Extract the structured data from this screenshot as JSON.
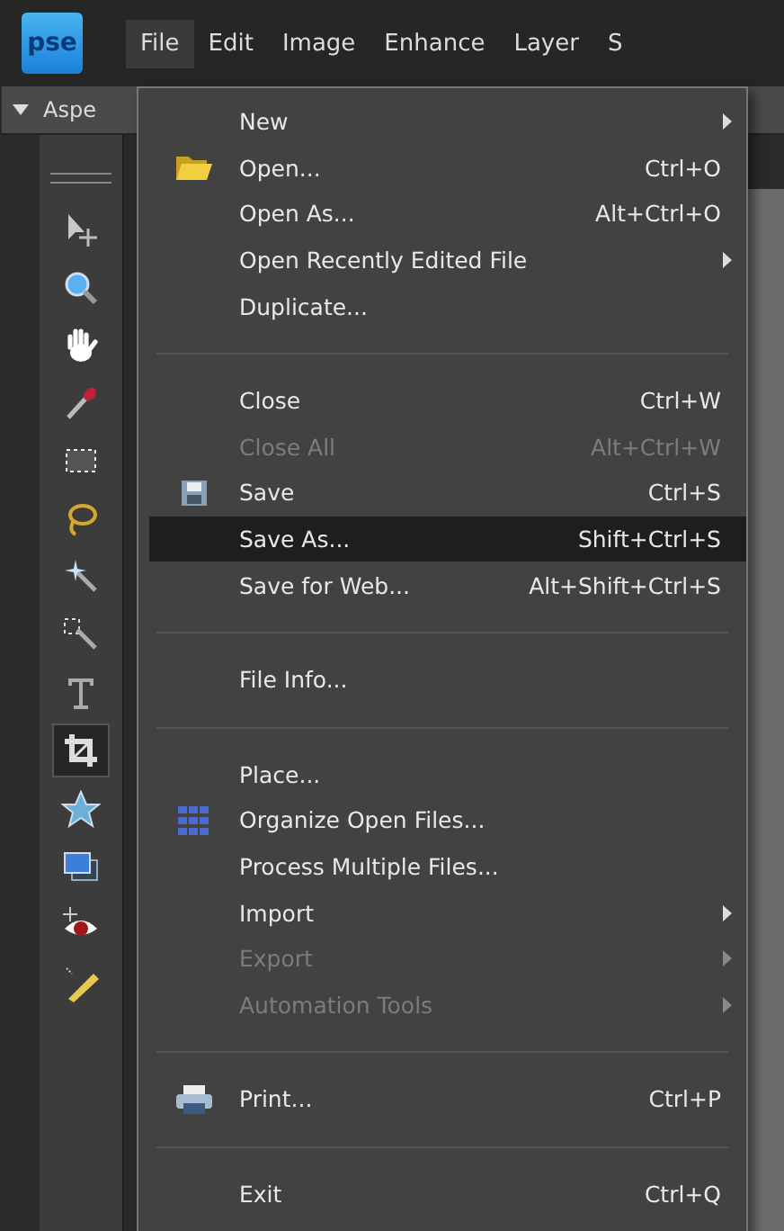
{
  "logo": "pse",
  "menubar": [
    {
      "label": "File",
      "selected": true
    },
    {
      "label": "Edit",
      "selected": false
    },
    {
      "label": "Image",
      "selected": false
    },
    {
      "label": "Enhance",
      "selected": false
    },
    {
      "label": "Layer",
      "selected": false
    },
    {
      "label": "S",
      "selected": false
    }
  ],
  "options_bar": {
    "label": "Aspe"
  },
  "tools": [
    {
      "selected": false
    },
    {
      "selected": false
    },
    {
      "selected": false
    },
    {
      "selected": false
    },
    {
      "selected": false
    },
    {
      "selected": false
    },
    {
      "selected": false
    },
    {
      "selected": false
    },
    {
      "selected": false
    },
    {
      "selected": true
    },
    {
      "selected": false
    },
    {
      "selected": false
    },
    {
      "selected": false
    },
    {
      "selected": false
    }
  ],
  "menu": [
    {
      "kind": "item",
      "label": "New",
      "disabled": false,
      "submenu": true,
      "selected": false
    },
    {
      "kind": "item",
      "label": "Open...",
      "shortcut": "Ctrl+O",
      "disabled": false,
      "submenu": false,
      "selected": false
    },
    {
      "kind": "item",
      "label": "Open As...",
      "shortcut": "Alt+Ctrl+O",
      "disabled": false,
      "submenu": false,
      "selected": false
    },
    {
      "kind": "item",
      "label": "Open Recently Edited File",
      "disabled": false,
      "submenu": true,
      "selected": false
    },
    {
      "kind": "item",
      "label": "Duplicate...",
      "disabled": false,
      "submenu": false,
      "selected": false
    },
    {
      "kind": "separator"
    },
    {
      "kind": "item",
      "label": "Close",
      "shortcut": "Ctrl+W",
      "disabled": false,
      "submenu": false,
      "selected": false
    },
    {
      "kind": "item",
      "label": "Close All",
      "shortcut": "Alt+Ctrl+W",
      "disabled": true,
      "submenu": false,
      "selected": false
    },
    {
      "kind": "item",
      "label": "Save",
      "shortcut": "Ctrl+S",
      "disabled": false,
      "submenu": false,
      "selected": false
    },
    {
      "kind": "item",
      "label": "Save As...",
      "shortcut": "Shift+Ctrl+S",
      "disabled": false,
      "submenu": false,
      "selected": true
    },
    {
      "kind": "item",
      "label": "Save for Web...",
      "shortcut": "Alt+Shift+Ctrl+S",
      "disabled": false,
      "submenu": false,
      "selected": false
    },
    {
      "kind": "separator"
    },
    {
      "kind": "item",
      "label": "File Info...",
      "disabled": false,
      "submenu": false,
      "selected": false
    },
    {
      "kind": "separator"
    },
    {
      "kind": "item",
      "label": "Place...",
      "disabled": false,
      "submenu": false,
      "selected": false
    },
    {
      "kind": "item",
      "label": "Organize Open Files...",
      "disabled": false,
      "submenu": false,
      "selected": false
    },
    {
      "kind": "item",
      "label": "Process Multiple Files...",
      "disabled": false,
      "submenu": false,
      "selected": false
    },
    {
      "kind": "item",
      "label": "Import",
      "disabled": false,
      "submenu": true,
      "selected": false
    },
    {
      "kind": "item",
      "label": "Export",
      "disabled": true,
      "submenu": true,
      "selected": false
    },
    {
      "kind": "item",
      "label": "Automation Tools",
      "disabled": true,
      "submenu": true,
      "selected": false
    },
    {
      "kind": "separator"
    },
    {
      "kind": "item",
      "label": "Print...",
      "shortcut": "Ctrl+P",
      "disabled": false,
      "submenu": false,
      "selected": false
    },
    {
      "kind": "separator"
    },
    {
      "kind": "item",
      "label": "Exit",
      "shortcut": "Ctrl+Q",
      "disabled": false,
      "submenu": false,
      "selected": false
    }
  ]
}
